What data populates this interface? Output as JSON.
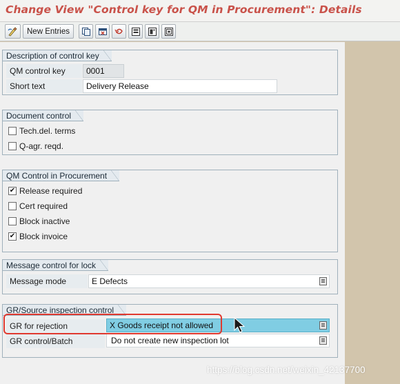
{
  "window": {
    "title": "Change View \"Control key for QM in Procurement\": Details"
  },
  "toolbar": {
    "new_entries_label": "New Entries",
    "icons": [
      "display-change-icon",
      "copy-as-icon",
      "delete-icon",
      "undo-change-icon",
      "select-all-icon",
      "select-block-icon",
      "deselect-all-icon"
    ]
  },
  "sections": {
    "description": {
      "title": "Description of control key",
      "control_key_label": "QM control key",
      "control_key_value": "0001",
      "short_text_label": "Short text",
      "short_text_value": "Delivery Release"
    },
    "document_control": {
      "title": "Document control",
      "items": [
        {
          "label": "Tech.del. terms",
          "checked": false
        },
        {
          "label": "Q-agr. reqd.",
          "checked": false
        }
      ]
    },
    "qm_control": {
      "title": "QM Control in Procurement",
      "items": [
        {
          "label": "Release required",
          "checked": true
        },
        {
          "label": "Cert required",
          "checked": false
        },
        {
          "label": "Block inactive",
          "checked": false
        },
        {
          "label": "Block invoice",
          "checked": true
        }
      ]
    },
    "message_control": {
      "title": "Message control for lock",
      "message_mode_label": "Message mode",
      "message_mode_value": "E Defects"
    },
    "gr_control": {
      "title": "GR/Source inspection control",
      "gr_rejection_label": "GR for rejection",
      "gr_rejection_value": "X Goods receipt not allowed",
      "gr_batch_label": "GR control/Batch",
      "gr_batch_value": "Do not create new inspection lot"
    }
  },
  "watermark": "https://blog.csdn.net/weixin_42137700",
  "colors": {
    "title": "#c9524a",
    "highlight_border": "#e0392f",
    "focused_field": "#80cde3",
    "background": "#d2c5ac"
  }
}
